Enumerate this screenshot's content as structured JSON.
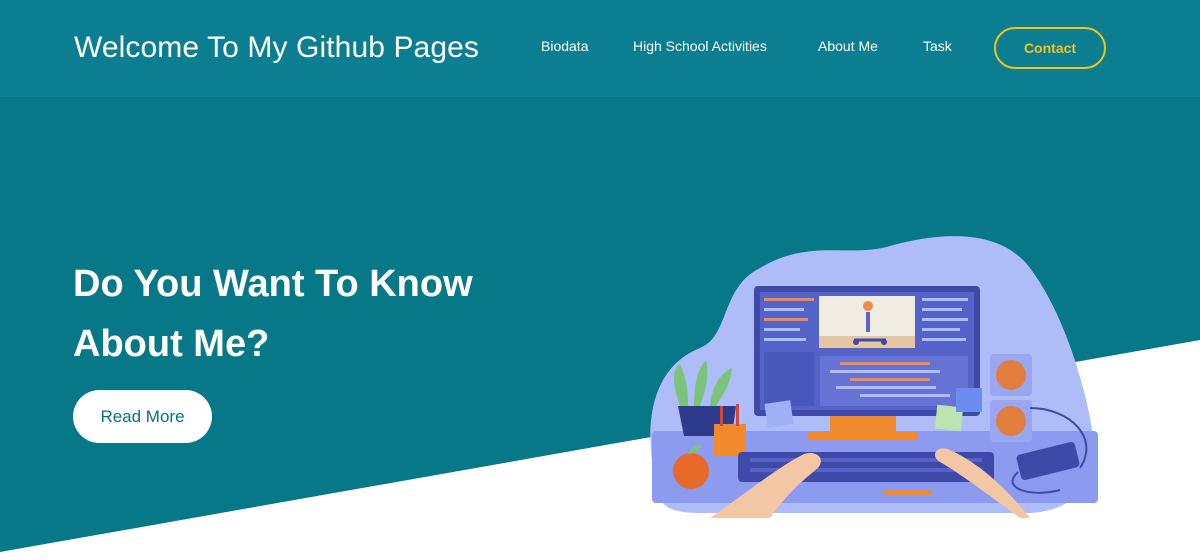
{
  "navbar": {
    "brand": "Welcome To My Github Pages",
    "links": [
      {
        "label": "Biodata"
      },
      {
        "label": "High School Activities"
      },
      {
        "label": "About Me"
      },
      {
        "label": "Task"
      }
    ],
    "contact_label": "Contact"
  },
  "hero": {
    "headline": "Do You Want To Know About Me?",
    "cta_label": "Read More",
    "illustration": "person-at-desktop-editing-video-illustration"
  },
  "colors": {
    "nav_bg": "#0b7f91",
    "hero_bg": "#067888",
    "accent": "#f2c319",
    "text": "#ffffff",
    "cta_text": "#0b6f80"
  }
}
